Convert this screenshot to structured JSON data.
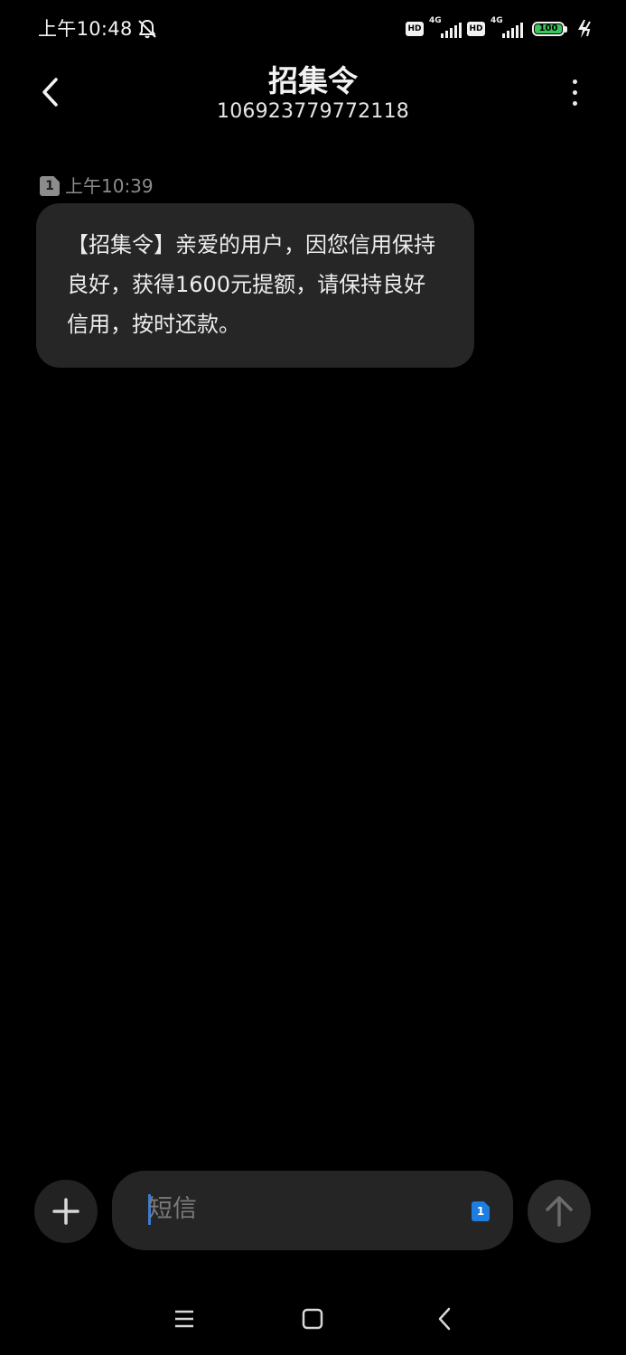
{
  "status_bar": {
    "time": "上午10:48",
    "notification_icon": "bell-off-icon",
    "sim1": {
      "hd": "HD",
      "network": "4G"
    },
    "sim2": {
      "hd": "HD",
      "network": "4G"
    },
    "battery_level": "100",
    "charging_icon": "lightning-icon",
    "battery_color": "#39c65a"
  },
  "header": {
    "back_icon": "chevron-left-icon",
    "contact_name": "招集令",
    "contact_number": "106923779772118",
    "more_icon": "more-vertical-icon"
  },
  "conversation": {
    "messages": [
      {
        "sim_slot": "1",
        "time": "上午10:39",
        "text": "【招集令】亲爱的用户，因您信用保持良好，获得1600元提额，请保持良好信用，按时还款。"
      }
    ]
  },
  "composer": {
    "attach_icon": "plus-icon",
    "placeholder": "短信",
    "sim_slot": "1",
    "send_icon": "arrow-up-icon",
    "accent_color": "#1e7de0"
  },
  "nav_bar": {
    "menu_icon": "menu-icon",
    "home_icon": "home-square-icon",
    "back_icon": "back-triangle-icon"
  }
}
